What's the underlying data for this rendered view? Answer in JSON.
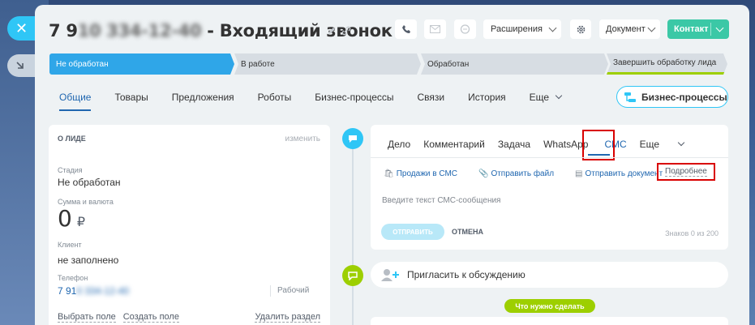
{
  "header": {
    "title_number": "7 9",
    "title_blurred": "10 334-12-40",
    "title_text": " - Входящий звонок"
  },
  "toolbar": {
    "extensions_label": "Расширения",
    "document_label": "Документ",
    "contact_label": "Контакт"
  },
  "stages": [
    {
      "label": "Не обработан"
    },
    {
      "label": "В работе"
    },
    {
      "label": "Обработан"
    },
    {
      "label": "Завершить обработку лида"
    }
  ],
  "tabs": [
    {
      "label": "Общие"
    },
    {
      "label": "Товары"
    },
    {
      "label": "Предложения"
    },
    {
      "label": "Роботы"
    },
    {
      "label": "Бизнес-процессы"
    },
    {
      "label": "Связи"
    },
    {
      "label": "История"
    },
    {
      "label": "Еще"
    }
  ],
  "bp_button_label": "Бизнес-процессы",
  "lead_card": {
    "heading": "О ЛИДЕ",
    "edit_label": "изменить",
    "stage_label": "Стадия",
    "stage_value": "Не обработан",
    "amount_label": "Сумма и валюта",
    "amount_value": "0",
    "currency": "₽",
    "client_label": "Клиент",
    "client_value": "не заполнено",
    "phone_label": "Телефон",
    "phone_value_visible": "7 91",
    "phone_value_blurred": "0 334-12-40",
    "phone_type": "Рабочий",
    "select_field": "Выбрать поле",
    "create_field": "Создать поле",
    "delete_section": "Удалить раздел"
  },
  "editor": {
    "tabs": [
      "Дело",
      "Комментарий",
      "Задача",
      "WhatsApp",
      "СМС",
      "Еще"
    ],
    "actions": [
      "Продажи в СМС",
      "Отправить файл",
      "Отправить документ"
    ],
    "more_label": "Подробнее",
    "placeholder": "Введите текст СМС-сообщения",
    "send_label": "ОТПРАВИТЬ",
    "cancel_label": "ОТМЕНА",
    "counter": "Знаков 0 из 200"
  },
  "invite_label": "Пригласить к обсуждению",
  "todo_label": "Что нужно сделать",
  "colors": {
    "accent": "#2fc6f6",
    "active_stage": "#2fa6e8",
    "contact": "#3bc8a6",
    "green": "#9dcf00",
    "highlight": "#d90000"
  }
}
